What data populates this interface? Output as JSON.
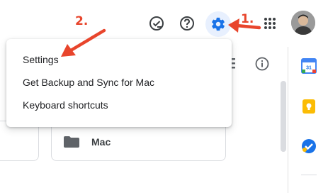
{
  "header": {
    "icons": [
      "support-icon",
      "help-icon",
      "gear-icon",
      "apps-grid-icon"
    ],
    "avatar": "user-avatar"
  },
  "settings_menu": {
    "items": [
      {
        "label": "Settings"
      },
      {
        "label": "Get Backup and Sync for Mac"
      },
      {
        "label": "Keyboard shortcuts"
      }
    ]
  },
  "content": {
    "folder_card": {
      "label": "Mac",
      "icon": "folder-icon"
    },
    "toolbar_icons": [
      "list-view-icon",
      "info-icon"
    ]
  },
  "side_panel": {
    "apps": [
      "calendar-icon",
      "keep-icon",
      "tasks-icon"
    ],
    "calendar_day": "31"
  },
  "annotations": {
    "step1": "1.",
    "step2": "2.",
    "color": "#e8452c"
  },
  "colors": {
    "accent": "#1a73e8",
    "settings_highlight": "#e8f0fe"
  }
}
